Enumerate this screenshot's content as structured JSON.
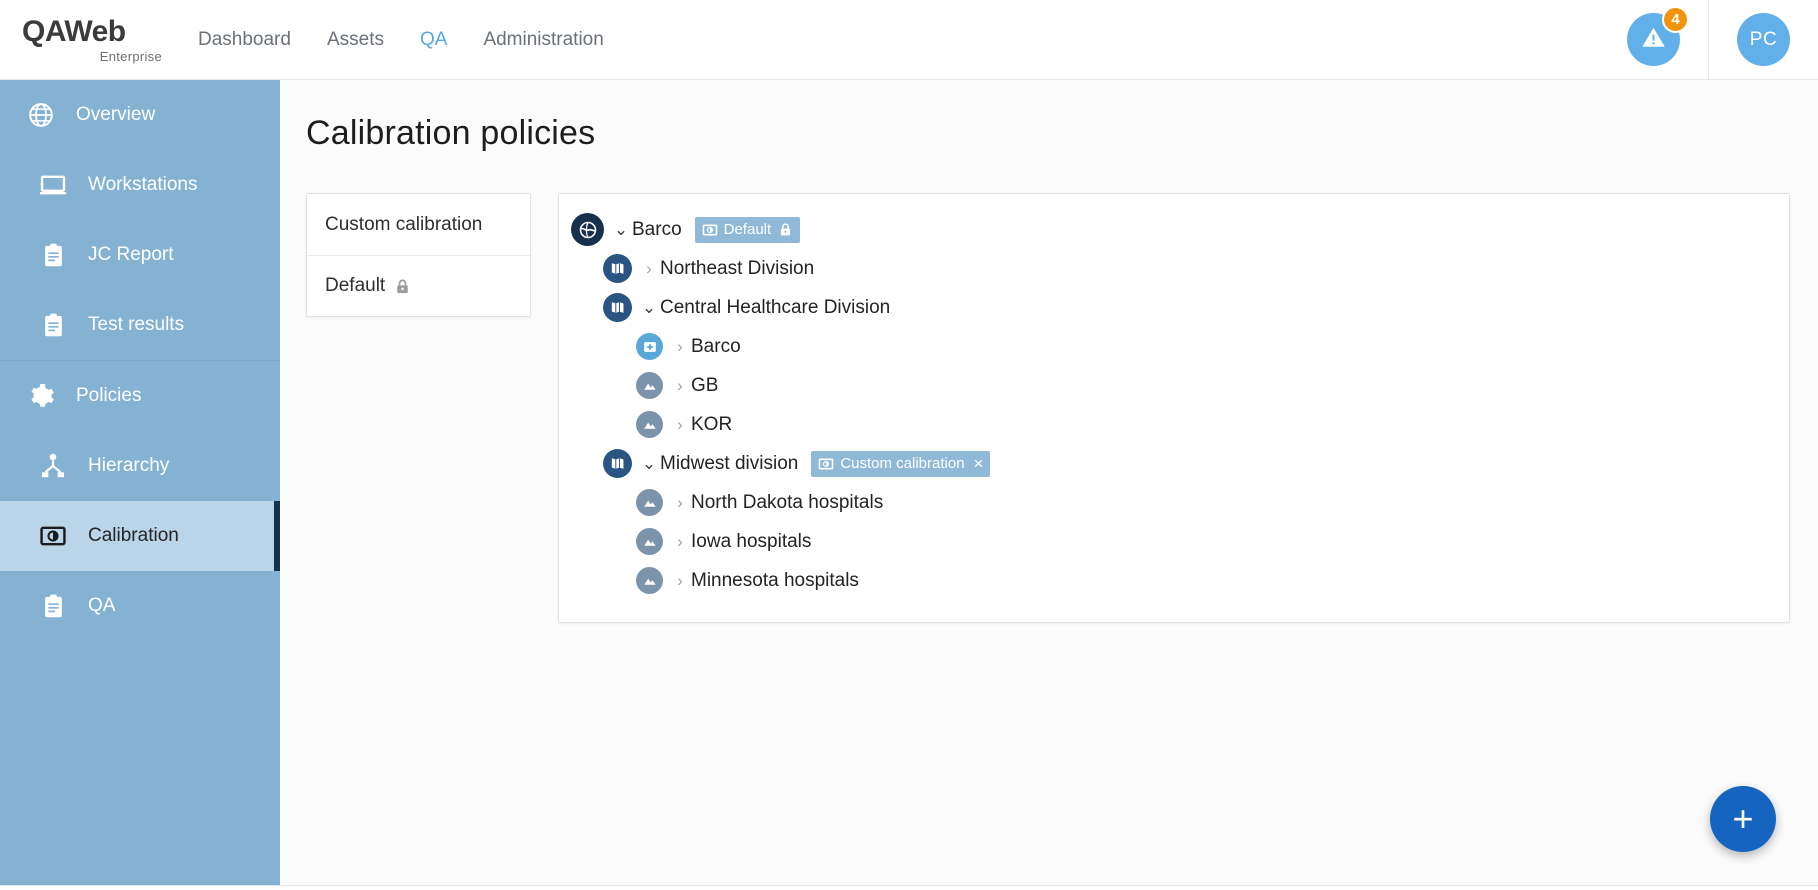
{
  "app": {
    "logo_primary": "QAWeb",
    "logo_secondary": "Enterprise"
  },
  "topnav": {
    "items": [
      {
        "label": "Dashboard",
        "active": false
      },
      {
        "label": "Assets",
        "active": false
      },
      {
        "label": "QA",
        "active": true
      },
      {
        "label": "Administration",
        "active": false
      }
    ],
    "notification": {
      "icon": "warning-triangle-icon",
      "badge_count": "4",
      "badge_color": "#f2950d",
      "circle_color": "#62b0ea"
    },
    "avatar": {
      "initials": "PC",
      "color": "#62b0ea"
    }
  },
  "sidebar": {
    "background": "#85b2d3",
    "active_background": "#b9d5e7",
    "accent_color": "#17304e",
    "items": [
      {
        "label": "Overview",
        "icon": "globe-icon",
        "active": false,
        "indent": false
      },
      {
        "label": "Workstations",
        "icon": "monitor-icon",
        "active": false,
        "indent": true
      },
      {
        "label": "JC Report",
        "icon": "clipboard-icon",
        "active": false,
        "indent": true
      },
      {
        "label": "Test results",
        "icon": "clipboard-icon",
        "active": false,
        "indent": true
      },
      {
        "label": "Policies",
        "icon": "gear-icon",
        "active": false,
        "indent": false
      },
      {
        "label": "Hierarchy",
        "icon": "hierarchy-icon",
        "active": false,
        "indent": true
      },
      {
        "label": "Calibration",
        "icon": "calibration-icon",
        "active": true,
        "indent": true
      },
      {
        "label": "QA",
        "icon": "clipboard-icon",
        "active": false,
        "indent": true
      }
    ]
  },
  "main": {
    "page_title": "Calibration policies",
    "policy_list": [
      {
        "label": "Custom calibration",
        "locked": false
      },
      {
        "label": "Default",
        "locked": true
      }
    ],
    "tree": [
      {
        "label": "Barco",
        "level": 1,
        "icon": "globe-node-icon",
        "expanded": true,
        "twisty": "⌄",
        "chip": {
          "label": "Default",
          "icon": "calibration-icon",
          "locked": true,
          "removable": false
        }
      },
      {
        "label": "Northeast Division",
        "level": 2,
        "icon": "division-icon",
        "expanded": false,
        "twisty": "›",
        "chip": null
      },
      {
        "label": "Central Healthcare Division",
        "level": 2,
        "icon": "division-icon",
        "expanded": true,
        "twisty": "⌄",
        "chip": null
      },
      {
        "label": "Barco",
        "level": 3,
        "icon": "hospital-icon",
        "expanded": false,
        "twisty": "›",
        "chip": null
      },
      {
        "label": "GB",
        "level": 3,
        "icon": "region-icon",
        "expanded": false,
        "twisty": "›",
        "chip": null
      },
      {
        "label": "KOR",
        "level": 3,
        "icon": "region-icon",
        "expanded": false,
        "twisty": "›",
        "chip": null
      },
      {
        "label": "Midwest division",
        "level": 2,
        "icon": "division-icon",
        "expanded": true,
        "twisty": "⌄",
        "chip": {
          "label": "Custom calibration",
          "icon": "calibration-icon",
          "locked": false,
          "removable": true,
          "remove_glyph": "×"
        }
      },
      {
        "label": "North Dakota hospitals",
        "level": 3,
        "icon": "region-icon",
        "expanded": false,
        "twisty": "›",
        "chip": null
      },
      {
        "label": "Iowa hospitals",
        "level": 3,
        "icon": "region-icon",
        "expanded": false,
        "twisty": "›",
        "chip": null
      },
      {
        "label": "Minnesota hospitals",
        "level": 3,
        "icon": "region-icon",
        "expanded": false,
        "twisty": "›",
        "chip": null
      }
    ],
    "fab": {
      "glyph": "+",
      "color": "#1565c0",
      "name": "add-policy"
    }
  }
}
